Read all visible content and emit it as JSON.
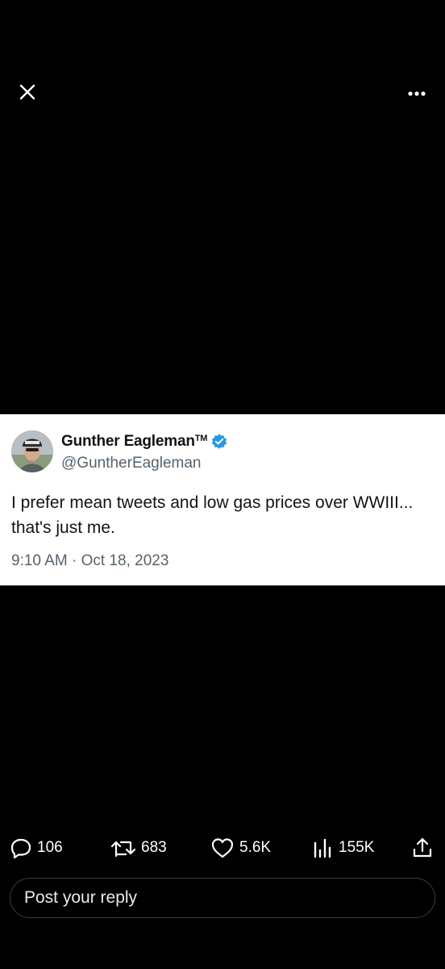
{
  "toolbar": {
    "close_icon": "close-icon",
    "more_icon": "more-horizontal-icon"
  },
  "tweet": {
    "author_name": "Gunther Eagleman",
    "author_name_mark": "TM",
    "verified": true,
    "handle": "@GuntherEagleman",
    "text": "I prefer mean tweets and low gas prices over WWIII...\n that's just me.",
    "timestamp": "9:10 AM · Oct 18, 2023"
  },
  "actions": {
    "replies": {
      "icon": "reply-icon",
      "count": "106"
    },
    "reposts": {
      "icon": "repost-icon",
      "count": "683"
    },
    "likes": {
      "icon": "heart-icon",
      "count": "5.6K"
    },
    "views": {
      "icon": "views-icon",
      "count": "155K"
    },
    "share": {
      "icon": "share-icon"
    }
  },
  "reply": {
    "placeholder": "Post your reply"
  },
  "colors": {
    "background": "#000000",
    "card": "#ffffff",
    "text_dark": "#0f1419",
    "text_muted": "#536471",
    "verified_blue": "#1d9bf0",
    "reply_border": "#3a3d41"
  }
}
